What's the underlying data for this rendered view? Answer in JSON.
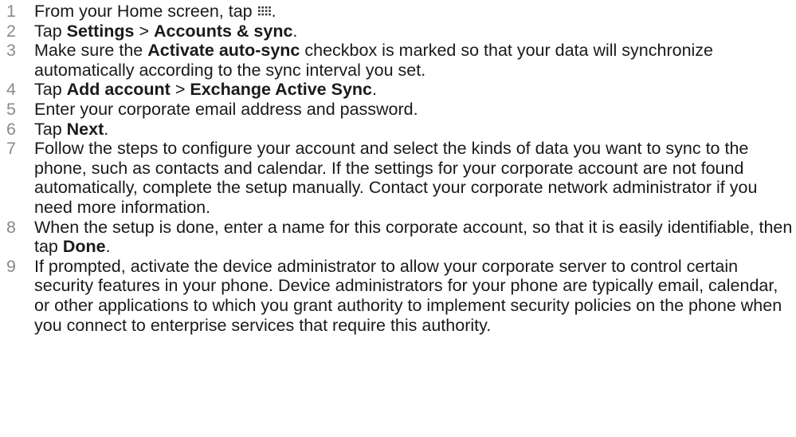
{
  "steps": [
    {
      "number": "1",
      "parts": [
        {
          "text": "From your Home screen, tap "
        },
        {
          "icon": "apps-grid-icon"
        },
        {
          "text": "."
        }
      ]
    },
    {
      "number": "2",
      "parts": [
        {
          "text": "Tap "
        },
        {
          "text": "Settings",
          "bold": true
        },
        {
          "text": " > "
        },
        {
          "text": "Accounts & sync",
          "bold": true
        },
        {
          "text": "."
        }
      ]
    },
    {
      "number": "3",
      "parts": [
        {
          "text": "Make sure the "
        },
        {
          "text": "Activate auto-sync",
          "bold": true
        },
        {
          "text": " checkbox is marked so that your data will synchronize automatically according to the sync interval you set."
        }
      ]
    },
    {
      "number": "4",
      "parts": [
        {
          "text": "Tap "
        },
        {
          "text": "Add account",
          "bold": true
        },
        {
          "text": " > "
        },
        {
          "text": "Exchange Active Sync",
          "bold": true
        },
        {
          "text": "."
        }
      ]
    },
    {
      "number": "5",
      "parts": [
        {
          "text": "Enter your corporate email address and password."
        }
      ]
    },
    {
      "number": "6",
      "parts": [
        {
          "text": "Tap "
        },
        {
          "text": "Next",
          "bold": true
        },
        {
          "text": "."
        }
      ]
    },
    {
      "number": "7",
      "parts": [
        {
          "text": "Follow the steps to configure your account and select the kinds of data you want to sync to the phone, such as contacts and calendar. If the settings for your corporate account are not found automatically, complete the setup manually. Contact your corporate network administrator if you need more information."
        }
      ]
    },
    {
      "number": "8",
      "parts": [
        {
          "text": "When the setup is done, enter a name for this corporate account, so that it is easily identifiable, then tap "
        },
        {
          "text": "Done",
          "bold": true
        },
        {
          "text": "."
        }
      ]
    },
    {
      "number": "9",
      "parts": [
        {
          "text": "If prompted, activate the device administrator to allow your corporate server to control certain security features in your phone. Device administrators for your phone are typically email, calendar, or other applications to which you grant authority to implement security policies on the phone when you connect to enterprise services that require this authority."
        }
      ]
    }
  ]
}
